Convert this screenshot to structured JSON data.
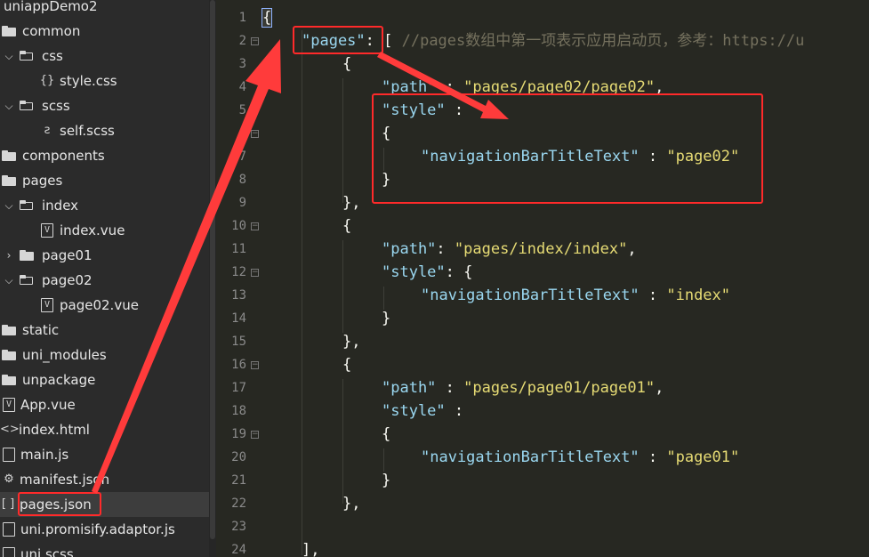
{
  "sidebar": {
    "items": [
      {
        "label": "uniappDemo2",
        "kind": "root"
      },
      {
        "label": "common",
        "kind": "folder-open"
      },
      {
        "label": "css",
        "kind": "folder-open"
      },
      {
        "label": "style.css",
        "kind": "css-file"
      },
      {
        "label": "scss",
        "kind": "folder-open"
      },
      {
        "label": "self.scss",
        "kind": "scss-file"
      },
      {
        "label": "components",
        "kind": "folder"
      },
      {
        "label": "pages",
        "kind": "folder"
      },
      {
        "label": "index",
        "kind": "folder-open"
      },
      {
        "label": "index.vue",
        "kind": "vue-file"
      },
      {
        "label": "page01",
        "kind": "folder-closed"
      },
      {
        "label": "page02",
        "kind": "folder-open"
      },
      {
        "label": "page02.vue",
        "kind": "vue-file"
      },
      {
        "label": "static",
        "kind": "folder"
      },
      {
        "label": "uni_modules",
        "kind": "folder"
      },
      {
        "label": "unpackage",
        "kind": "folder"
      },
      {
        "label": "App.vue",
        "kind": "vue-file"
      },
      {
        "label": "index.html",
        "kind": "html-file"
      },
      {
        "label": "main.js",
        "kind": "js-file"
      },
      {
        "label": "manifest.json",
        "kind": "settings-file"
      },
      {
        "label": "pages.json",
        "kind": "json-file"
      },
      {
        "label": "uni.promisify.adaptor.js",
        "kind": "js-file"
      },
      {
        "label": "uni.scss",
        "kind": "scss-file"
      }
    ]
  },
  "editor": {
    "line_numbers": [
      "1",
      "2",
      "3",
      "4",
      "5",
      "6",
      "7",
      "8",
      "9",
      "10",
      "11",
      "12",
      "13",
      "14",
      "15",
      "16",
      "17",
      "18",
      "19",
      "20",
      "21",
      "22",
      "23",
      "24"
    ],
    "code": {
      "l1": "{",
      "l2_key": "\"pages\"",
      "l2_punct": ": [ ",
      "l2_comment": "//pages数组中第一项表示应用启动页，参考：https://u",
      "l3": "{",
      "l4_key": "\"path\"",
      "l4_punct": " : ",
      "l4_val": "\"pages/page02/page02\"",
      "l4_tail": ",",
      "l5_key": "\"style\"",
      "l5_punct": " :",
      "l6": "{",
      "l7_key": "\"navigationBarTitleText\"",
      "l7_punct": " : ",
      "l7_val": "\"page02\"",
      "l8": "}",
      "l9": "},",
      "l10": "{",
      "l11_key": "\"path\"",
      "l11_punct": ": ",
      "l11_val": "\"pages/index/index\"",
      "l11_tail": ",",
      "l12_key": "\"style\"",
      "l12_punct": ": {",
      "l13_key": "\"navigationBarTitleText\"",
      "l13_punct": " : ",
      "l13_val": "\"index\"",
      "l14": "}",
      "l15": "},",
      "l16": "{",
      "l17_key": "\"path\"",
      "l17_punct": " : ",
      "l17_val": "\"pages/page01/page01\"",
      "l17_tail": ",",
      "l18_key": "\"style\"",
      "l18_punct": " :",
      "l19": "{",
      "l20_key": "\"navigationBarTitleText\"",
      "l20_punct": " : ",
      "l20_val": "\"page01\"",
      "l21": "}",
      "l22": "},",
      "l23": "",
      "l24": "],"
    }
  },
  "annotations": {
    "highlight_color": "#ff2a2a"
  }
}
